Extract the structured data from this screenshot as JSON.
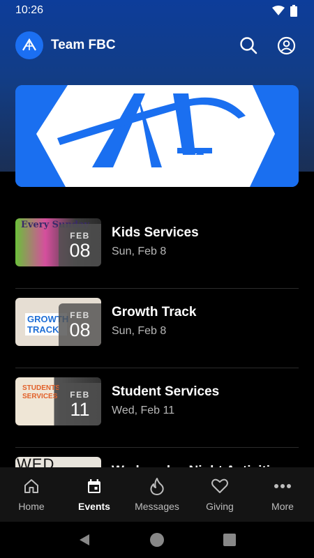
{
  "status": {
    "time": "10:26"
  },
  "header": {
    "title": "Team FBC"
  },
  "events": [
    {
      "title": "Kids Services",
      "date": "Sun, Feb 8",
      "month": "FEB",
      "day": "08",
      "thumb_text": "Every Sunday"
    },
    {
      "title": "Growth Track",
      "date": "Sun, Feb 8",
      "month": "FEB",
      "day": "08",
      "thumb_text": "GROWTH TRACK"
    },
    {
      "title": "Student Services",
      "date": "Wed, Feb 11",
      "month": "FEB",
      "day": "11",
      "thumb_text": "STUDENTS SERVICES"
    },
    {
      "title": "Wednesday Night Activities",
      "date": "",
      "month": "",
      "day": "",
      "thumb_text": "WED"
    }
  ],
  "nav": [
    {
      "label": "Home",
      "icon": "home-icon"
    },
    {
      "label": "Events",
      "icon": "calendar-icon",
      "active": true
    },
    {
      "label": "Messages",
      "icon": "flame-icon"
    },
    {
      "label": "Giving",
      "icon": "heart-icon"
    },
    {
      "label": "More",
      "icon": "more-icon"
    }
  ],
  "colors": {
    "brand_blue": "#1a6ff0",
    "header_gradient_top": "#0d3d9a",
    "background": "#000000"
  }
}
